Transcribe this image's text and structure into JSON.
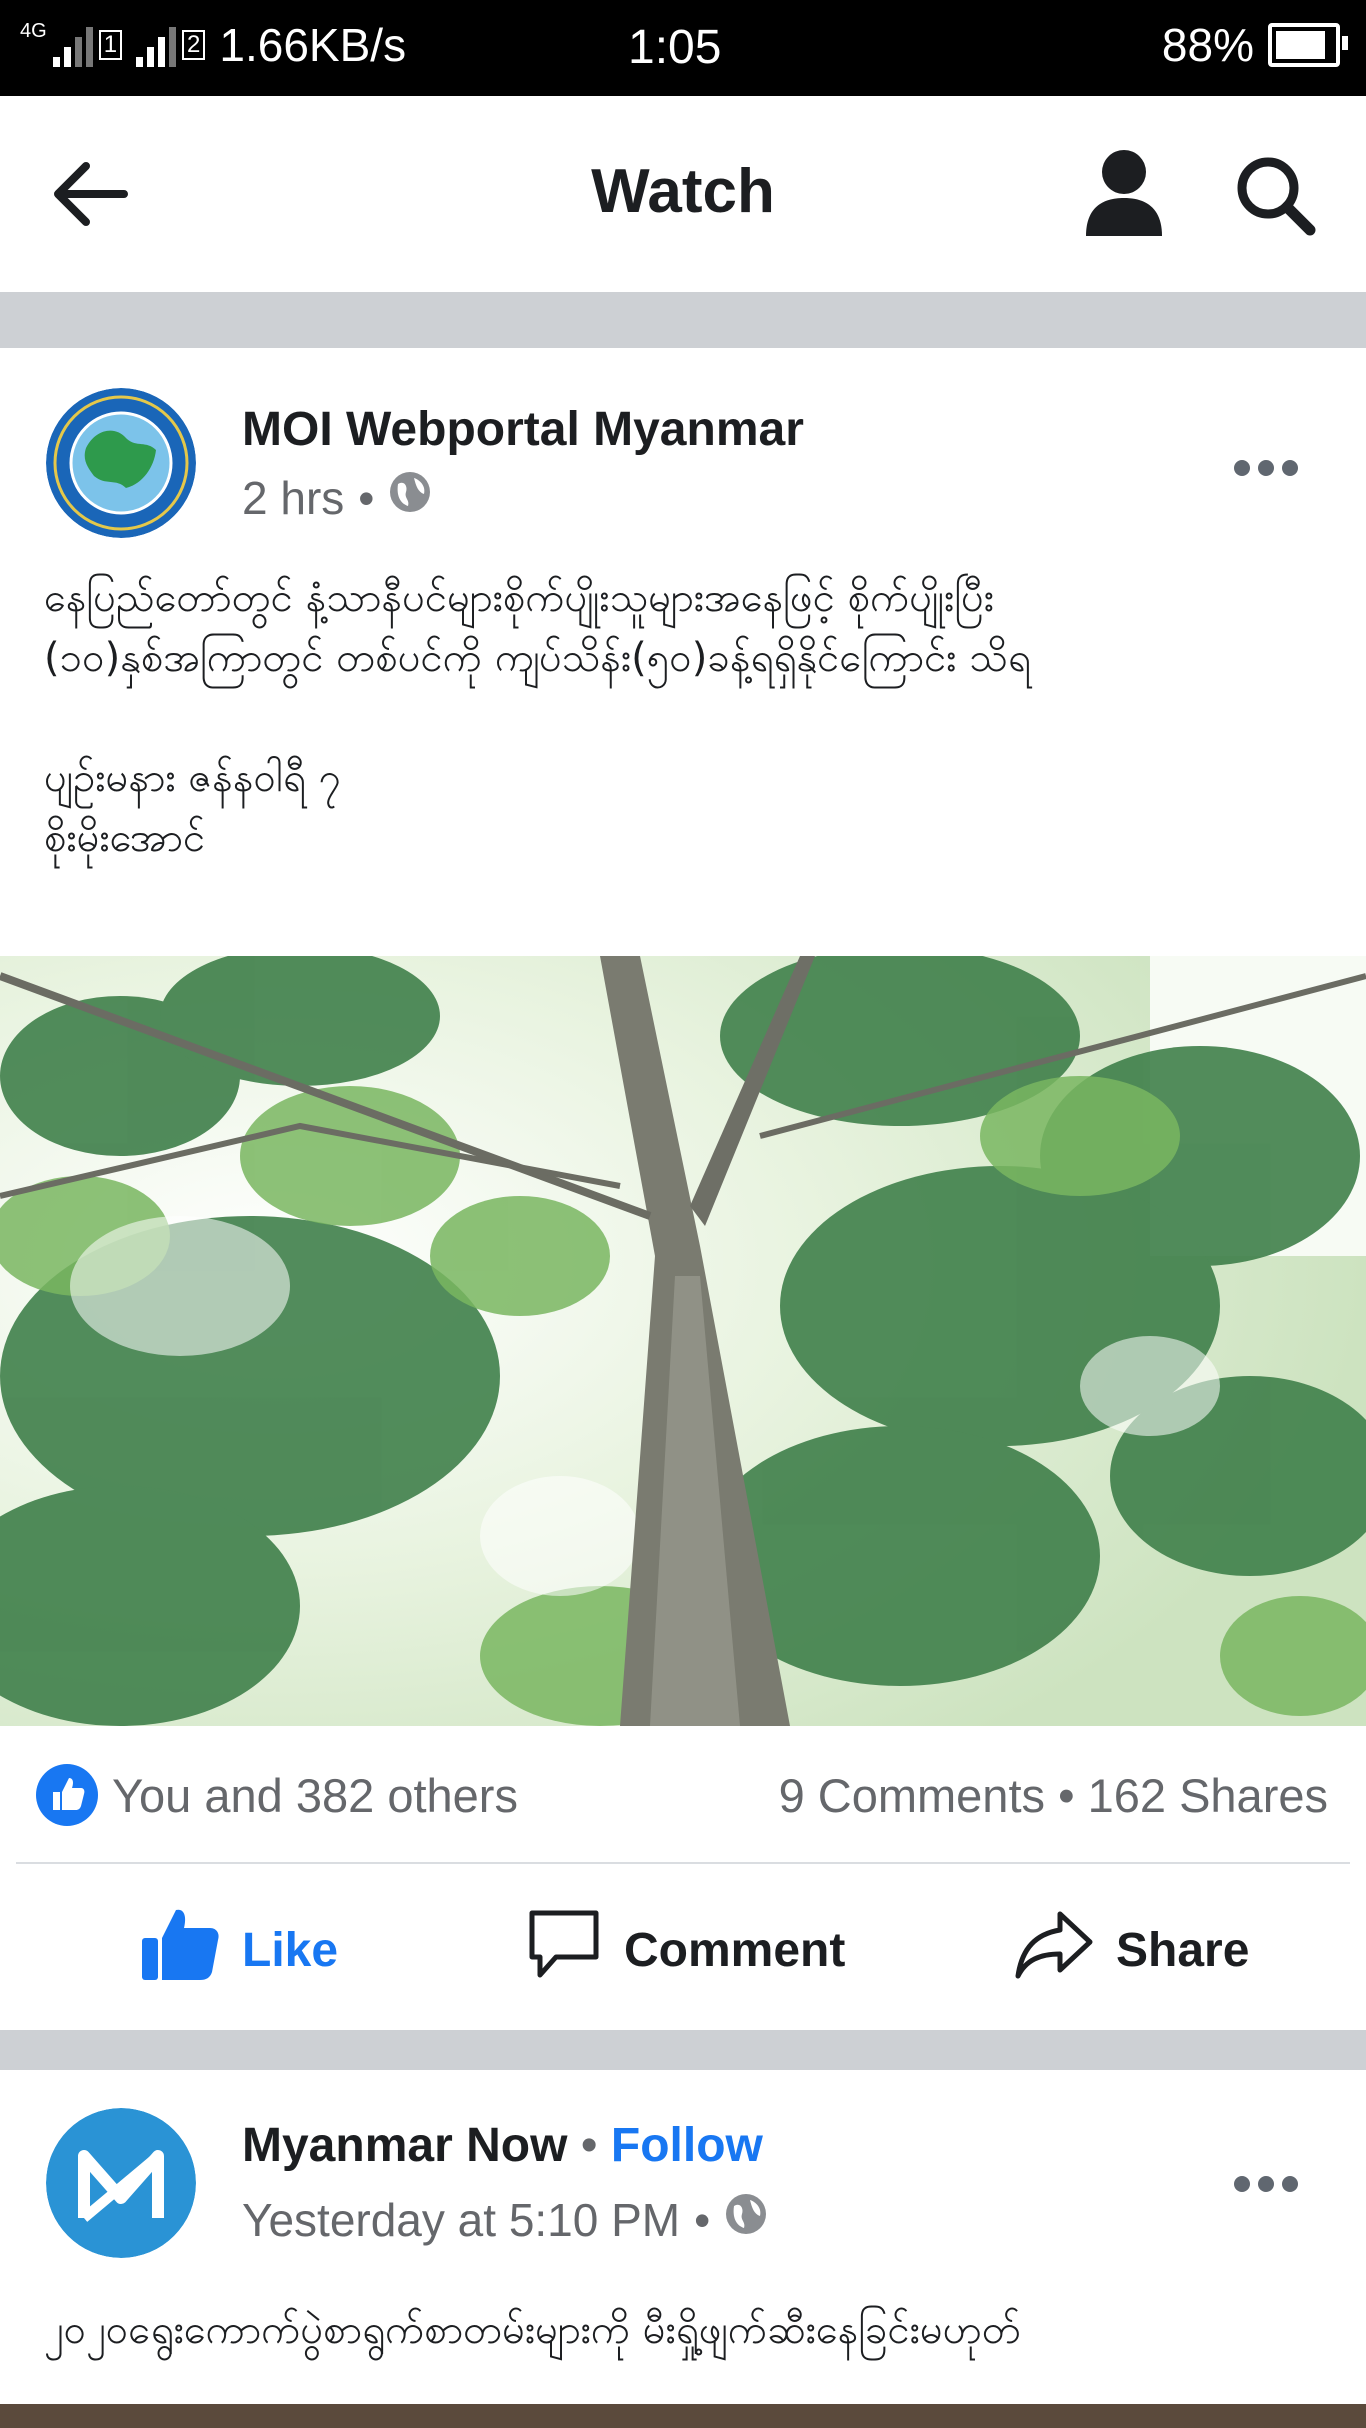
{
  "status_bar": {
    "network_type": "4G",
    "sim1": "1",
    "sim2": "2",
    "speed": "1.66KB/s",
    "time": "1:05",
    "battery_percent": "88%",
    "battery_level": 0.88
  },
  "header": {
    "title": "Watch",
    "back_icon": "back-arrow-icon",
    "profile_icon": "person-icon",
    "search_icon": "search-icon"
  },
  "posts": [
    {
      "author": "MOI Webportal Myanmar",
      "time": "2 hrs",
      "meta_separator": "•",
      "privacy_icon": "globe-icon",
      "text": "နေပြည်တော်တွင် နံ့သာနီပင်များစိုက်ပျိုးသူများအနေဖြင့် စိုက်ပျိုးပြီး\n(၁၀)နှစ်အကြာတွင် တစ်ပင်ကို ကျပ်သိန်း(၅၀)ခန့်ရရှိနိုင်ကြောင်း သိရ\n\nပျဥ်းမနား      ဇန်နဝါရီ ၇\nစိုးမိုးအောင်",
      "reactions_text": "You and 382 others",
      "comments_text": "9 Comments",
      "counts_separator": "•",
      "shares_text": "162 Shares",
      "actions": {
        "like": "Like",
        "comment": "Comment",
        "share": "Share"
      }
    },
    {
      "author": "Myanmar Now",
      "follow_separator": "•",
      "follow_label": "Follow",
      "time": "Yesterday at 5:10 PM",
      "meta_separator": "•",
      "privacy_icon": "globe-icon",
      "text": "၂၀၂၀ရွေးကောက်ပွဲစာရွက်စာတမ်းများကို မီးရှို့ဖျက်ဆီးနေခြင်းမဟုတ်"
    }
  ],
  "colors": {
    "accent_blue": "#1877f2",
    "meta_gray": "#65676b",
    "divider_gray": "#cdd0d4",
    "status_bar_bg": "#000000"
  }
}
